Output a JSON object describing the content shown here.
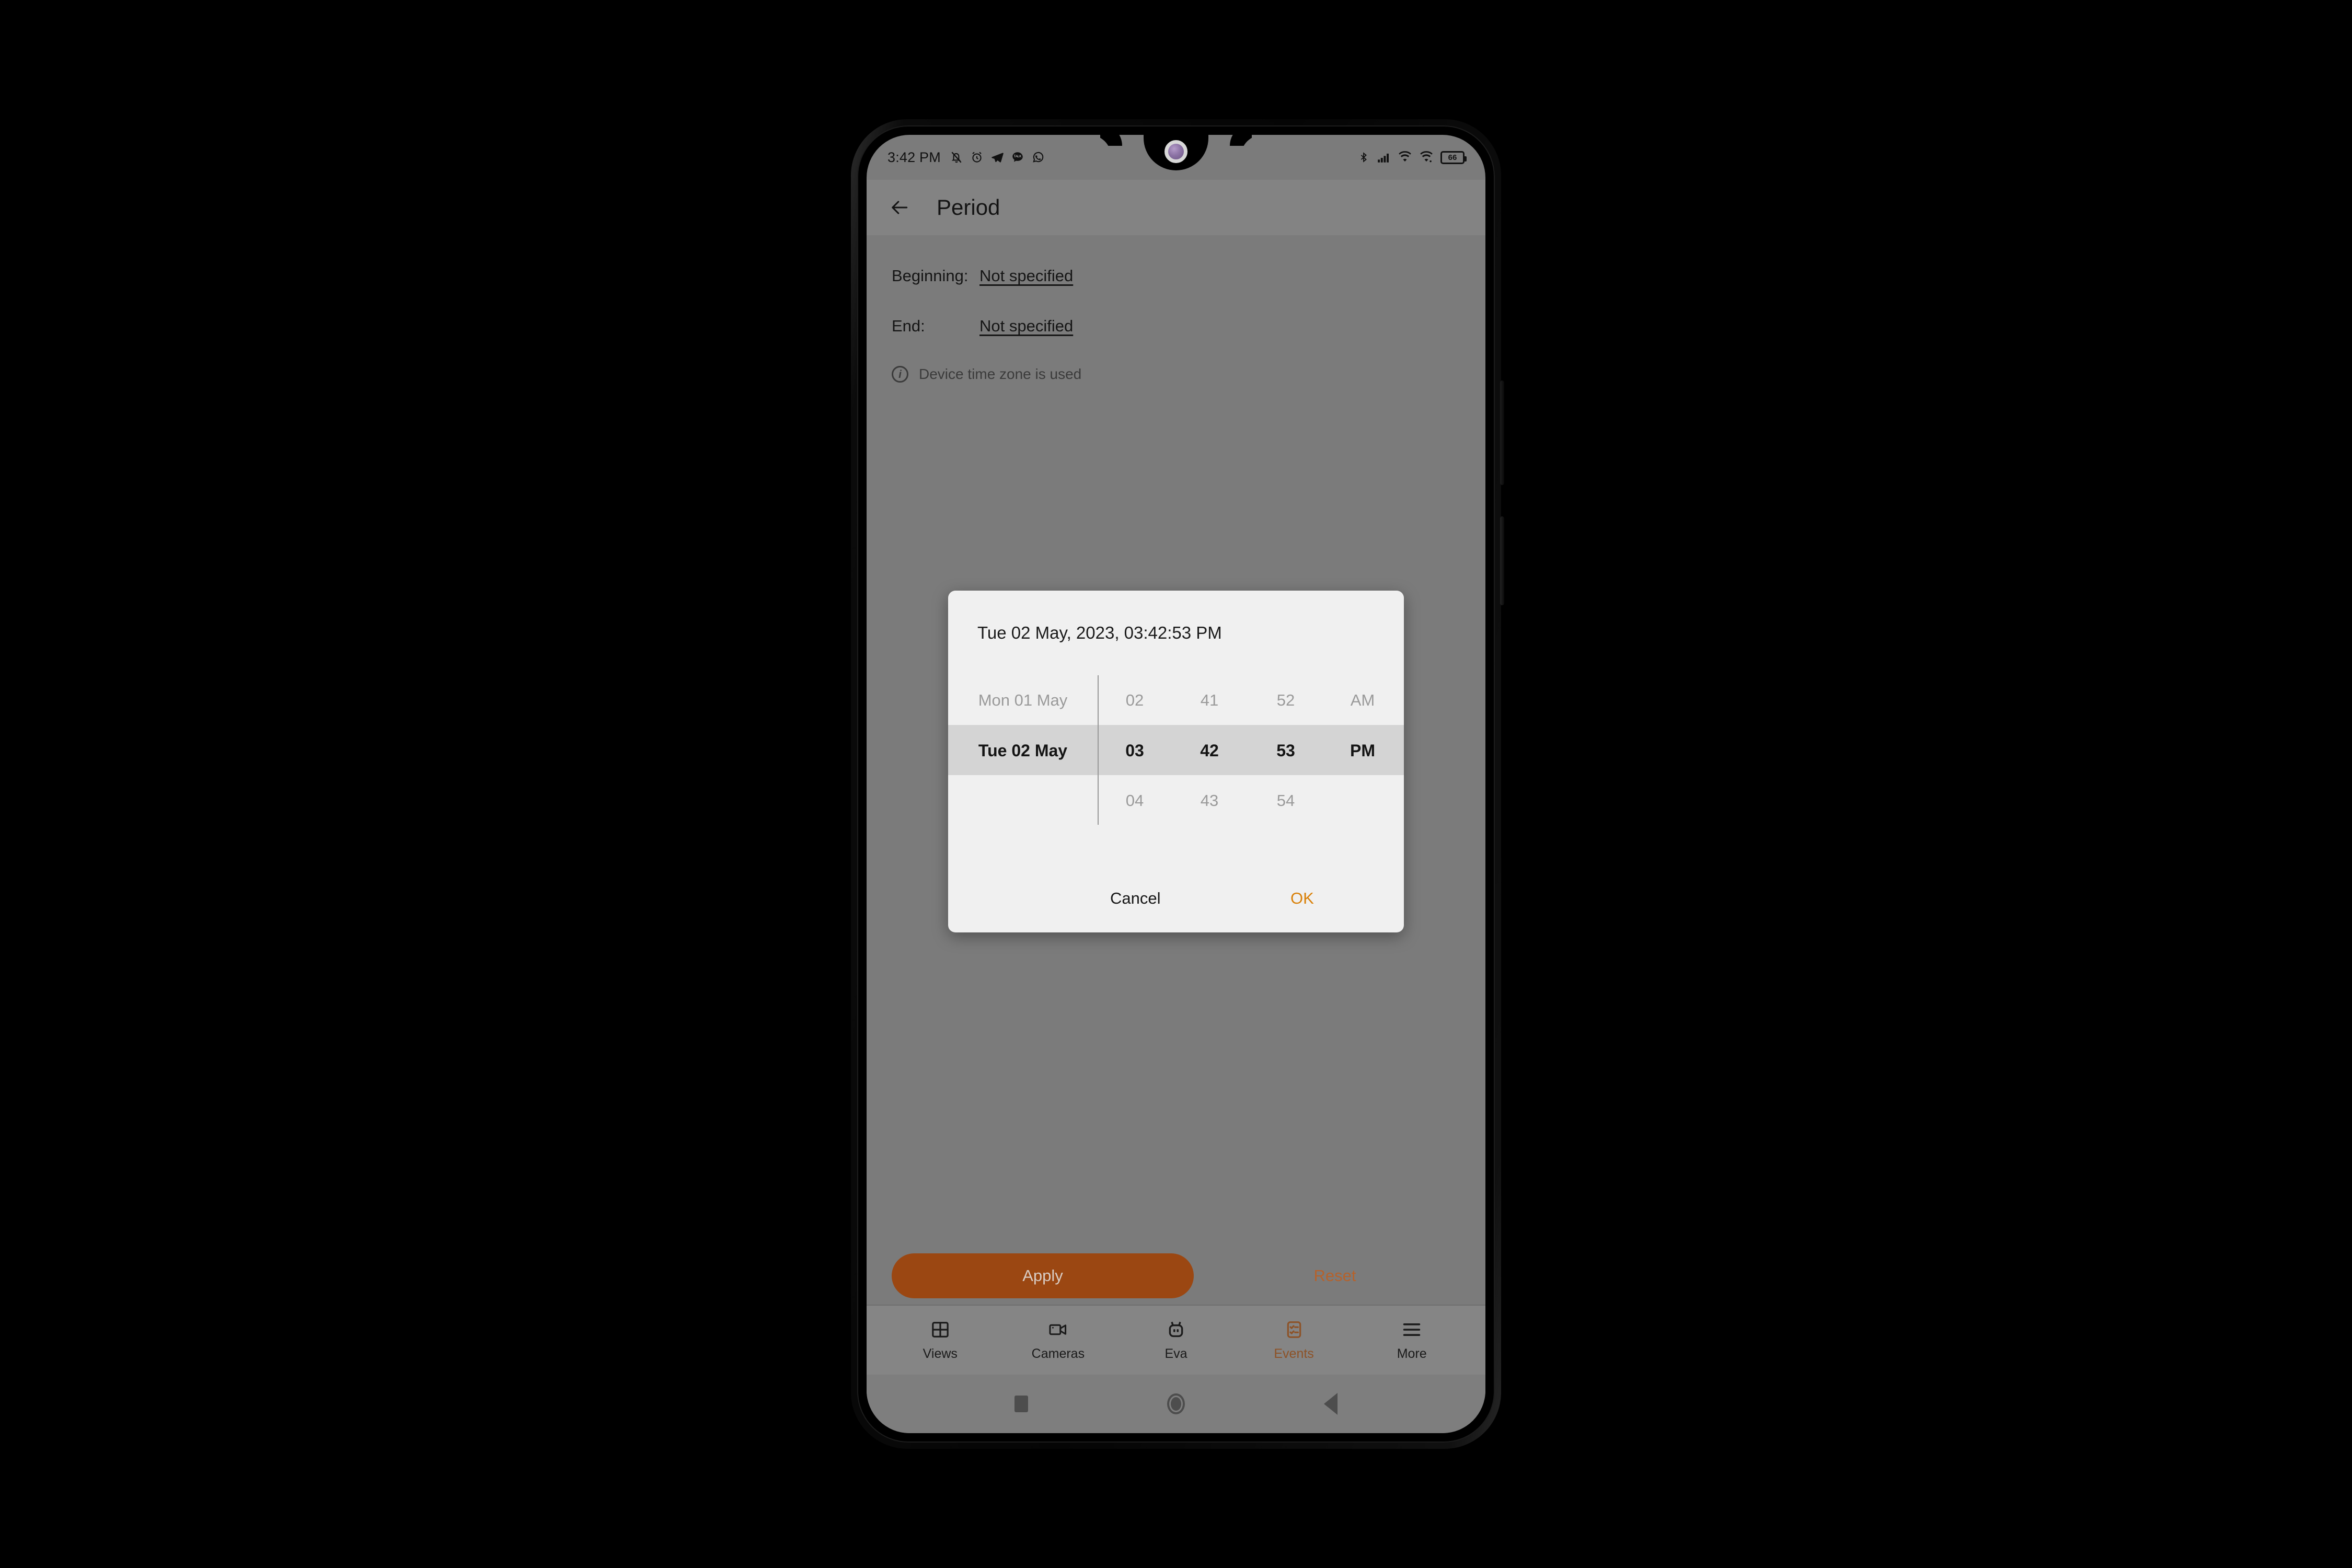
{
  "status_bar": {
    "time": "3:42 PM",
    "left_icons": [
      "mute-bell-icon",
      "alarm-clock-icon",
      "telegram-icon",
      "chat-bubble-icon",
      "whatsapp-icon"
    ],
    "right_icons": [
      "bluetooth-icon",
      "signal-bars-icon",
      "wifi-icon",
      "wifi-calling-icon",
      "battery-icon"
    ],
    "battery_level": "66"
  },
  "app_bar": {
    "back_icon": "back-arrow-icon",
    "title": "Period"
  },
  "content": {
    "beginning_label": "Beginning:",
    "beginning_value": "Not specified",
    "end_label": "End:",
    "end_value": "Not specified",
    "timezone_icon": "info-icon",
    "timezone_note": "Device time zone is used"
  },
  "actions": {
    "apply_label": "Apply",
    "reset_label": "Reset"
  },
  "bottom_nav": {
    "items": [
      {
        "label": "Views",
        "icon": "grid-icon",
        "active": false
      },
      {
        "label": "Cameras",
        "icon": "video-camera-icon",
        "active": false
      },
      {
        "label": "Eva",
        "icon": "robot-head-icon",
        "active": false
      },
      {
        "label": "Events",
        "icon": "checklist-icon",
        "active": true
      },
      {
        "label": "More",
        "icon": "hamburger-menu-icon",
        "active": false
      }
    ]
  },
  "android_nav": {
    "recents": "square-recents-icon",
    "home": "circle-home-icon",
    "back": "triangle-back-icon"
  },
  "dialog": {
    "header": "Tue 02 May, 2023, 03:42:53 PM",
    "picker": {
      "columns": [
        "date",
        "hour",
        "minute",
        "second",
        "meridiem"
      ],
      "rows": [
        {
          "date": "Mon 01 May",
          "hour": "02",
          "minute": "41",
          "second": "52",
          "meridiem": "AM",
          "selected": false
        },
        {
          "date": "Tue 02 May",
          "hour": "03",
          "minute": "42",
          "second": "53",
          "meridiem": "PM",
          "selected": true
        },
        {
          "date": "",
          "hour": "04",
          "minute": "43",
          "second": "54",
          "meridiem": "",
          "selected": false
        }
      ]
    },
    "cancel_label": "Cancel",
    "ok_label": "OK"
  },
  "colors": {
    "accent_orange": "#d98008",
    "apply_button": "#9b4712",
    "reset_text": "#b5622c",
    "nav_active": "#8d5227",
    "dialog_bg": "#f0f0f0",
    "picker_highlight": "#d4d4d4",
    "screen_scrim": "#7b7b7b"
  }
}
